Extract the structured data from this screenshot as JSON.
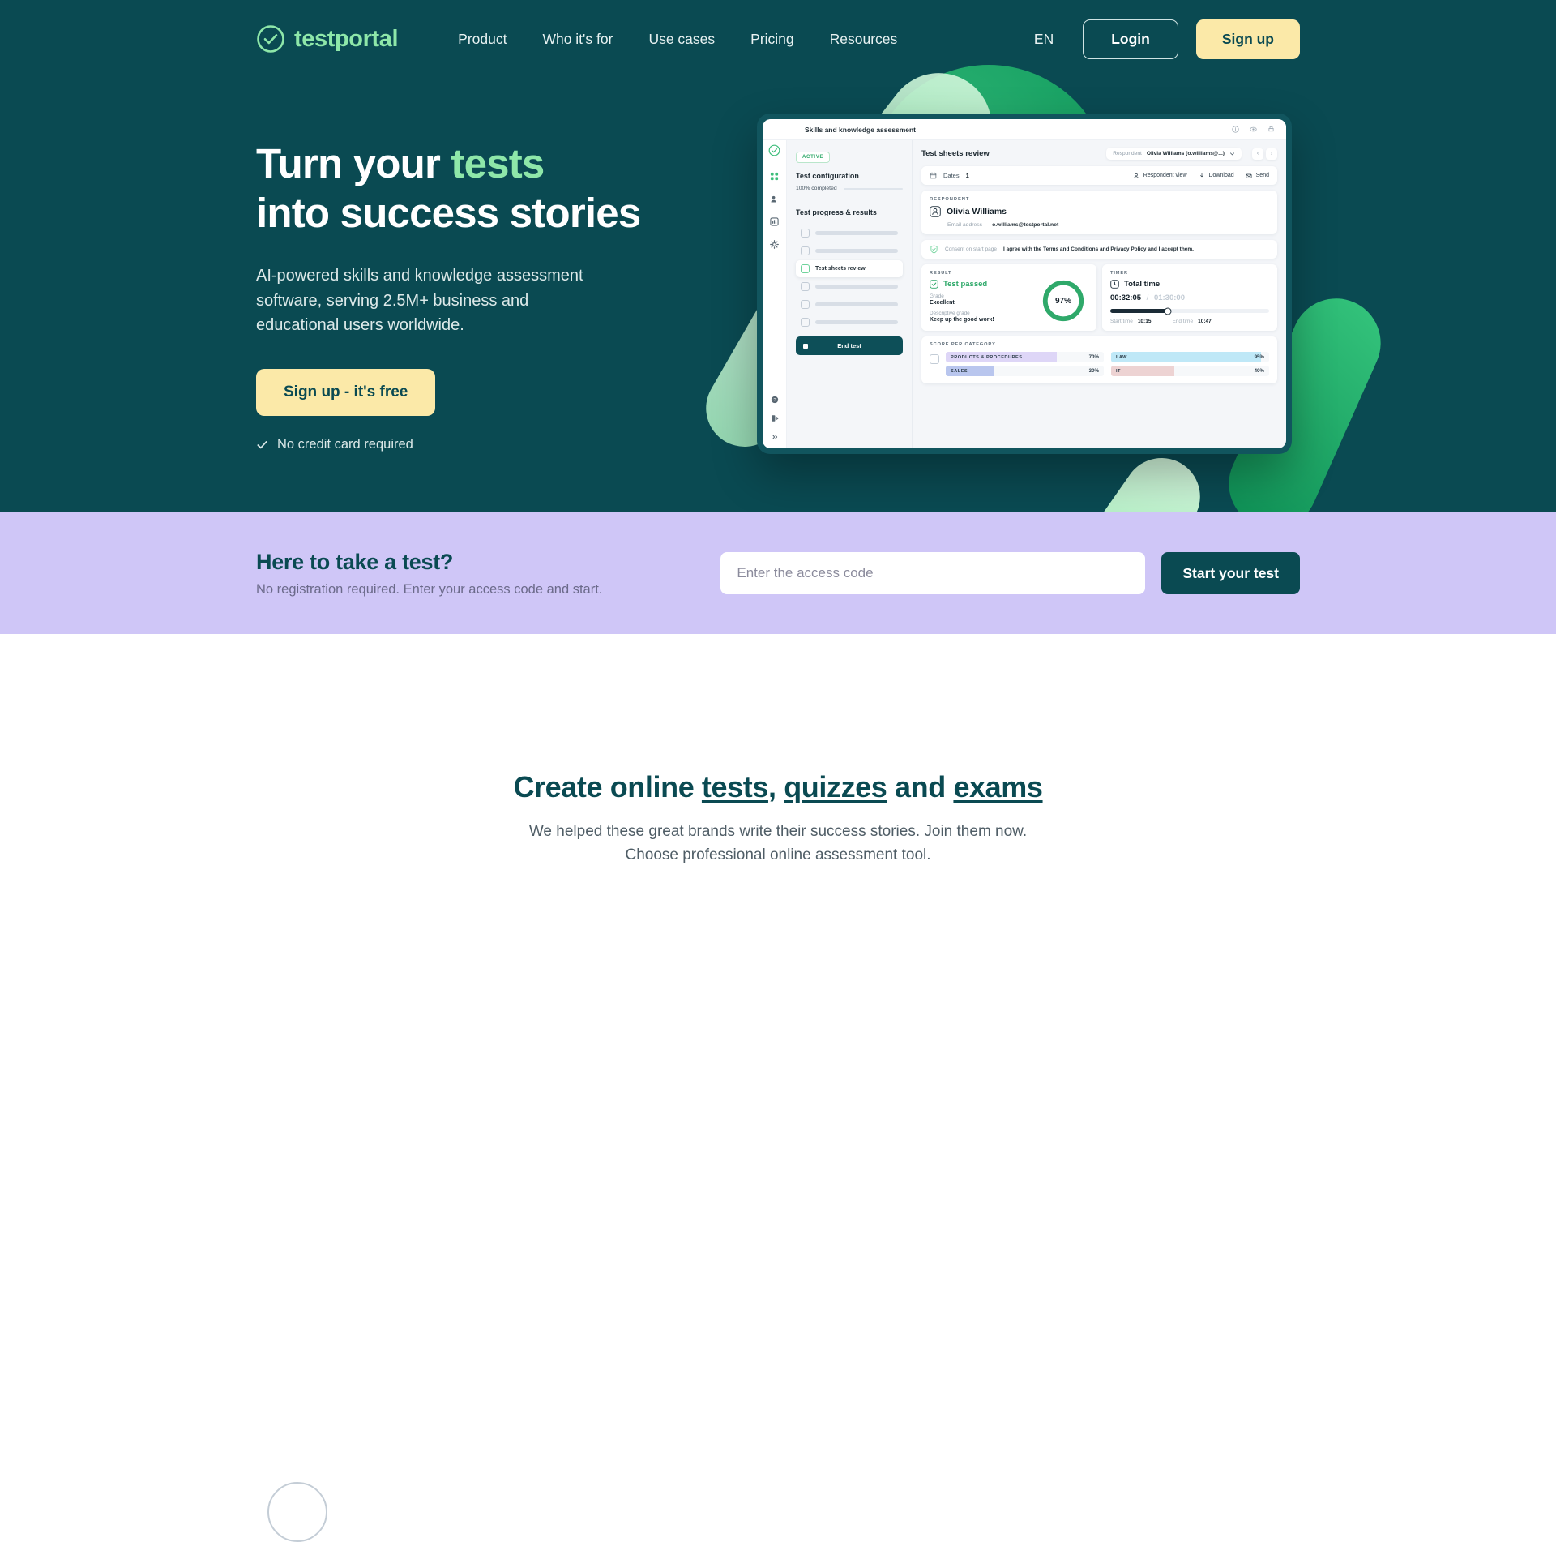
{
  "header": {
    "logo_text": "testportal",
    "logo_icon": "check-circle-icon",
    "nav": [
      {
        "label": "Product"
      },
      {
        "label": "Who it's for"
      },
      {
        "label": "Use cases"
      },
      {
        "label": "Pricing"
      },
      {
        "label": "Resources"
      }
    ],
    "language": "EN",
    "login_label": "Login",
    "signup_label": "Sign up"
  },
  "hero": {
    "title_line1_a": "Turn your ",
    "title_line1_b": "tests",
    "title_line2": "into success stories",
    "subtitle": "AI-powered skills and knowledge assessment software, serving 2.5M+ business and educational users worldwide.",
    "cta_label": "Sign up - it's free",
    "note": "No credit card required",
    "note_icon": "check-icon"
  },
  "mockup": {
    "topbar_title": "Skills and knowledge assessment",
    "topbar_icons": [
      "info-icon",
      "eye-icon",
      "print-icon"
    ],
    "rail_icons": [
      "grid-icon",
      "respondents-icon",
      "reports-icon",
      "gear-icon",
      "help-icon",
      "logout-icon",
      "expand-icon"
    ],
    "left": {
      "badge": "ACTIVE",
      "config_title": "Test configuration",
      "progress_label": "100% completed",
      "progress_pct": 100,
      "results_title": "Test progress & results",
      "menu": [
        {
          "label": "",
          "active": false
        },
        {
          "label": "",
          "active": false
        },
        {
          "label": "Test sheets review",
          "active": true
        },
        {
          "label": "",
          "active": false
        },
        {
          "label": "",
          "active": false
        },
        {
          "label": "",
          "active": false
        }
      ],
      "end_test_label": "End test"
    },
    "right": {
      "title": "Test sheets review",
      "respondent_select_label": "Respondent",
      "respondent_select_value": "Olivia Williams (o.williams@...)",
      "pager_prev": "‹",
      "pager_next": "›",
      "dates_label": "Dates",
      "dates_value": "1",
      "toolbar": [
        {
          "label": "Respondent view",
          "icon": "user-icon"
        },
        {
          "label": "Download",
          "icon": "download-icon"
        },
        {
          "label": "Send",
          "icon": "mail-icon"
        }
      ],
      "respondent_kicker": "RESPONDENT",
      "respondent_name": "Olivia Williams",
      "email_label": "Email address",
      "email_value": "o.williams@testportal.net",
      "consent_label": "Consent on start page",
      "consent_text": "I agree with the Terms and Conditions and Privacy Policy and I accept them.",
      "result": {
        "kicker": "RESULT",
        "status": "Test passed",
        "grade_label": "Grade",
        "grade_value": "Excellent",
        "desc_label": "Descriptive grade",
        "desc_value": "Keep up the good work!",
        "score_pct": "97%",
        "score_value": 97
      },
      "timer": {
        "kicker": "TIMER",
        "title": "Total time",
        "used": "00:32:05",
        "separator": "/",
        "total": "01:30:00",
        "start_label": "Start time",
        "start_value": "10:15",
        "end_label": "End time",
        "end_value": "10:47"
      },
      "score_per_category": {
        "kicker": "SCORE PER CATEGORY",
        "items": [
          {
            "name": "PRODUCTS & PROCEDURES",
            "pct": 70,
            "pct_label": "70%",
            "color": "#ded6f7"
          },
          {
            "name": "LAW",
            "pct": 95,
            "pct_label": "95%",
            "color": "#bfe8f7"
          },
          {
            "name": "SALES",
            "pct": 30,
            "pct_label": "30%",
            "color": "#b9c6ee"
          },
          {
            "name": "IT",
            "pct": 40,
            "pct_label": "40%",
            "color": "#edd3d3"
          }
        ]
      }
    }
  },
  "band": {
    "title": "Here to take a test?",
    "subtitle": "No registration required. Enter your access code and start.",
    "input_placeholder": "Enter the access code",
    "input_value": "",
    "button_label": "Start your test"
  },
  "brands": {
    "title_a": "Create online ",
    "title_tests": "tests",
    "title_comma": ", ",
    "title_quizzes": "quizzes",
    "title_and": " and ",
    "title_exams": "exams",
    "sub_line1": "We helped these great brands write their success stories. Join them now.",
    "sub_line2": "Choose professional online assessment tool."
  },
  "colors": {
    "teal": "#0a4a52",
    "mint": "#8ee7a9",
    "cream": "#fbe9a8",
    "lavender": "#cfc6f7",
    "green": "#2fa96a"
  }
}
